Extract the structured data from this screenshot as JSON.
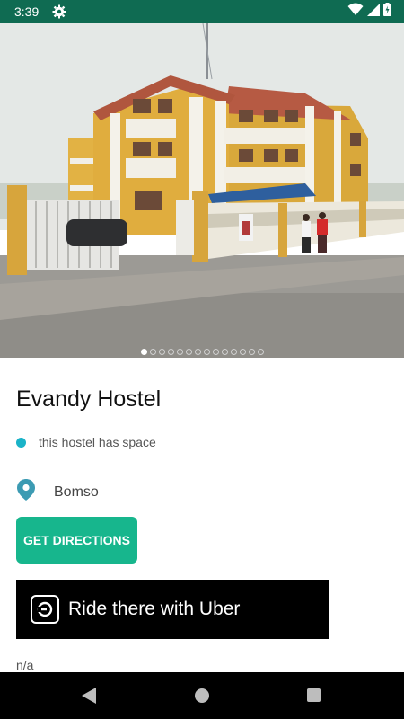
{
  "status_bar": {
    "time": "3:39",
    "icons": [
      "gear-icon",
      "wifi-icon",
      "signal-icon",
      "battery-icon"
    ],
    "background": "#0f6b52"
  },
  "gallery": {
    "image_description": "photo of a yellow and white multi-storey hostel building",
    "page_count": 14,
    "active_index": 0
  },
  "hostel": {
    "name": "Evandy Hostel",
    "availability": "this hostel has space",
    "availability_color": "#1ab3c8",
    "location_icon": "map-pin-icon",
    "location": "Bomso",
    "extra": "n/a"
  },
  "actions": {
    "directions_label": "GET DIRECTIONS",
    "directions_color": "#17b68d",
    "uber_label": "Ride there with Uber"
  },
  "nav_bar": {
    "icons": [
      "back-icon",
      "home-icon",
      "recents-icon"
    ]
  }
}
